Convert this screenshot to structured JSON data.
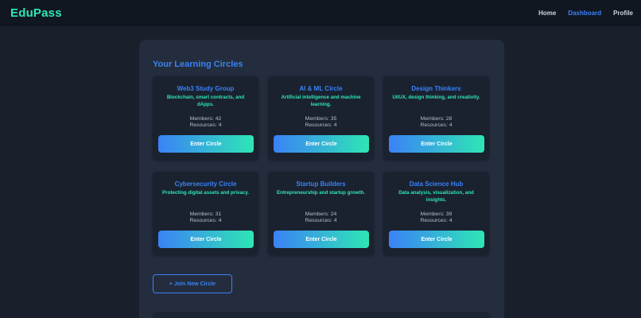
{
  "nav": {
    "brand": "EduPass",
    "links": [
      "Home",
      "Dashboard",
      "Profile"
    ],
    "active": "Dashboard"
  },
  "main": {
    "title": "Your Learning Circles",
    "circles": [
      {
        "name": "Web3 Study Group",
        "desc": "Blockchain, smart contracts, and dApps.",
        "members": "Members: 42",
        "resources": "Resources: 4",
        "button": "Enter Circle"
      },
      {
        "name": "AI & ML Circle",
        "desc": "Artificial intelligence and machine learning.",
        "members": "Members: 35",
        "resources": "Resources: 4",
        "button": "Enter Circle"
      },
      {
        "name": "Design Thinkers",
        "desc": "UI/UX, design thinking, and creativity.",
        "members": "Members: 28",
        "resources": "Resources: 4",
        "button": "Enter Circle"
      },
      {
        "name": "Cybersecurity Circle",
        "desc": "Protecting digital assets and privacy.",
        "members": "Members: 31",
        "resources": "Resources: 4",
        "button": "Enter Circle"
      },
      {
        "name": "Startup Builders",
        "desc": "Entrepreneurship and startup growth.",
        "members": "Members: 24",
        "resources": "Resources: 4",
        "button": "Enter Circle"
      },
      {
        "name": "Data Science Hub",
        "desc": "Data analysis, visualization, and insights.",
        "members": "Members: 39",
        "resources": "Resources: 4",
        "button": "Enter Circle"
      }
    ],
    "join_label": "+ Join New Circle"
  },
  "colors": {
    "accent_blue": "#3b82f6",
    "accent_teal": "#2ee6b5",
    "background": "#1a202b",
    "panel": "#232d3d",
    "card": "#1a2230"
  }
}
